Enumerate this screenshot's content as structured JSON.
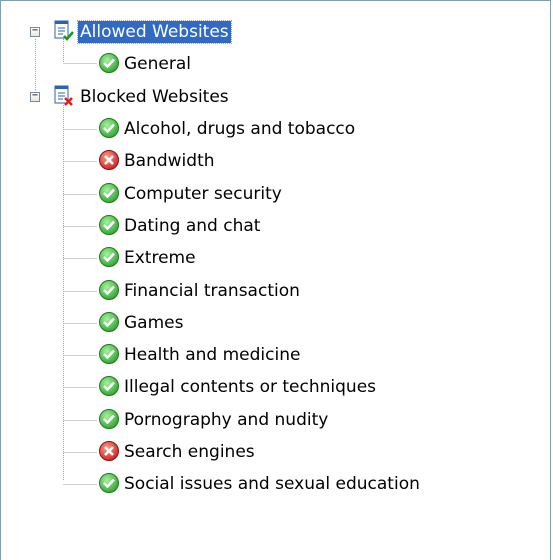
{
  "tree": {
    "allowed": {
      "label": "Allowed Websites",
      "expander": "−",
      "icon": "allowed-list-icon",
      "selected": true,
      "children": [
        {
          "label": "General",
          "status": "allowed"
        }
      ]
    },
    "blocked": {
      "label": "Blocked Websites",
      "expander": "−",
      "icon": "blocked-list-icon",
      "children": [
        {
          "label": "Alcohol, drugs and tobacco",
          "status": "allowed"
        },
        {
          "label": "Bandwidth",
          "status": "blocked"
        },
        {
          "label": "Computer security",
          "status": "allowed"
        },
        {
          "label": "Dating and chat",
          "status": "allowed"
        },
        {
          "label": "Extreme",
          "status": "allowed"
        },
        {
          "label": "Financial transaction",
          "status": "allowed"
        },
        {
          "label": "Games",
          "status": "allowed"
        },
        {
          "label": "Health and medicine",
          "status": "allowed"
        },
        {
          "label": "Illegal contents or techniques",
          "status": "allowed"
        },
        {
          "label": "Pornography and nudity",
          "status": "allowed"
        },
        {
          "label": "Search engines",
          "status": "blocked"
        },
        {
          "label": "Social issues and sexual education",
          "status": "allowed"
        }
      ]
    }
  },
  "colors": {
    "selection": "#316ac5",
    "allowed_icon": "#3cb43c",
    "blocked_icon": "#d83c3c",
    "border": "#7f9db9"
  }
}
